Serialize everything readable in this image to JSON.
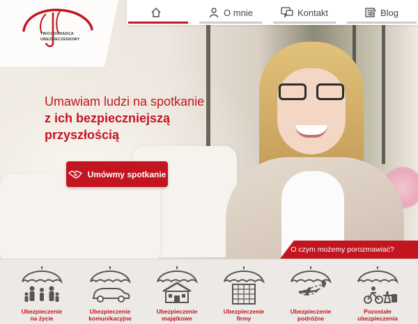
{
  "logo": {
    "line1": "TWÓJ DORADCA",
    "line2": "UBEZPIECZENIOWY"
  },
  "nav": {
    "items": [
      {
        "label": "",
        "icon": "home-icon",
        "active": true
      },
      {
        "label": "O mnie",
        "icon": "user-icon",
        "active": false
      },
      {
        "label": "Kontakt",
        "icon": "chat-icon",
        "active": false
      },
      {
        "label": "Blog",
        "icon": "blog-icon",
        "active": false
      }
    ]
  },
  "hero": {
    "line1": "Umawiam ludzi na spotkanie",
    "line2": "z ich bezpieczniejszą",
    "line3": "przyszłością",
    "cta_label": "Umówmy spotkanie",
    "cta_icon": "handshake-icon"
  },
  "ribbon": {
    "text": "O czym możemy porozmawiać?"
  },
  "categories": [
    {
      "line1": "Ubezpieczenie",
      "line2": "na życie",
      "icon": "family-umbrella-icon"
    },
    {
      "line1": "Ubezpieczenie",
      "line2": "komunikacyjne",
      "icon": "car-umbrella-icon"
    },
    {
      "line1": "Ubezpieczenie",
      "line2": "majątkowe",
      "icon": "house-umbrella-icon"
    },
    {
      "line1": "Ubezpieczenie",
      "line2": "firmy",
      "icon": "building-umbrella-icon"
    },
    {
      "line1": "Ubezpieczenie",
      "line2": "podróżne",
      "icon": "plane-umbrella-icon"
    },
    {
      "line1": "Pozostałe",
      "line2": "ubezpieczenia",
      "icon": "misc-umbrella-icon"
    }
  ],
  "colors": {
    "brand_red": "#c3151f",
    "icon_gray": "#555555"
  }
}
